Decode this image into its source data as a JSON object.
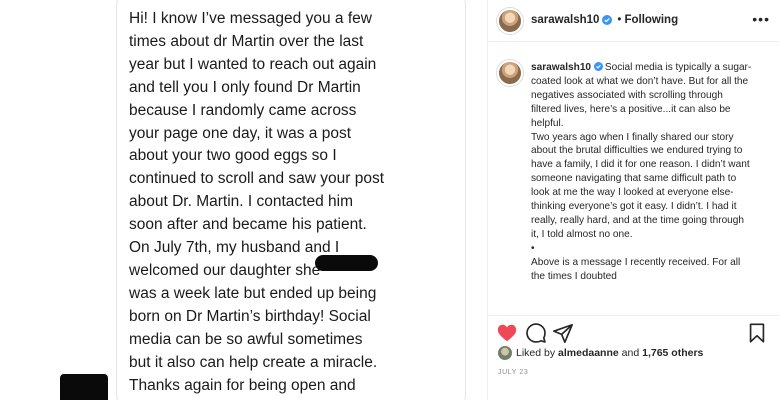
{
  "message": {
    "text": "Hi! I know I’ve messaged you a few\ntimes about dr Martin over the last\nyear but I wanted to reach out again\nand tell you I only found Dr Martin\nbecause I randomly came across\nyour page one day, it was a post\nabout your two good eggs so I\ncontinued to scroll and saw your post\nabout Dr. Martin. I contacted him\nsoon after and became his patient.\nOn July 7th, my husband and I\nwelcomed our daughter              she\nwas a week late but ended up being\nborn on Dr Martin’s birthday! Social\nmedia can be so awful sometimes\nbut it also can help create a miracle.\nThanks again for being open and\nleading me to the right doctor!"
  },
  "header": {
    "username": "sarawalsh10",
    "separator": "•",
    "follow_status": "Following",
    "more_icon": "more-horizontal-icon"
  },
  "caption": {
    "username": "sarawalsh10",
    "text": "Social media is typically a sugar-coated look at what we don’t have. But for all the negatives associated with scrolling through filtered lives, here’s a positive...it can also be helpful.\nTwo years ago when I finally shared our story about the brutal difficulties we endured trying to have a family, I did it for one reason. I didn’t want someone navigating that same difficult path to look at me the way I looked at everyone else- thinking everyone’s got it easy. I didn’t. I had it really, really hard, and at the time going through it, I told almost no one.\n•\nAbove is a message I recently received. For all the times I doubted"
  },
  "actions": {
    "icons": [
      "heart-filled-icon",
      "comment-icon",
      "share-icon",
      "bookmark-icon"
    ],
    "heart_color": "#ed4956"
  },
  "likes": {
    "prefix": "Liked by",
    "user": "almedaanne",
    "connector": "and",
    "count": "1,765 others"
  },
  "date": "JULY 23",
  "colors": {
    "verified": "#3897f0",
    "text": "#262626",
    "muted": "#8e8e8e"
  }
}
